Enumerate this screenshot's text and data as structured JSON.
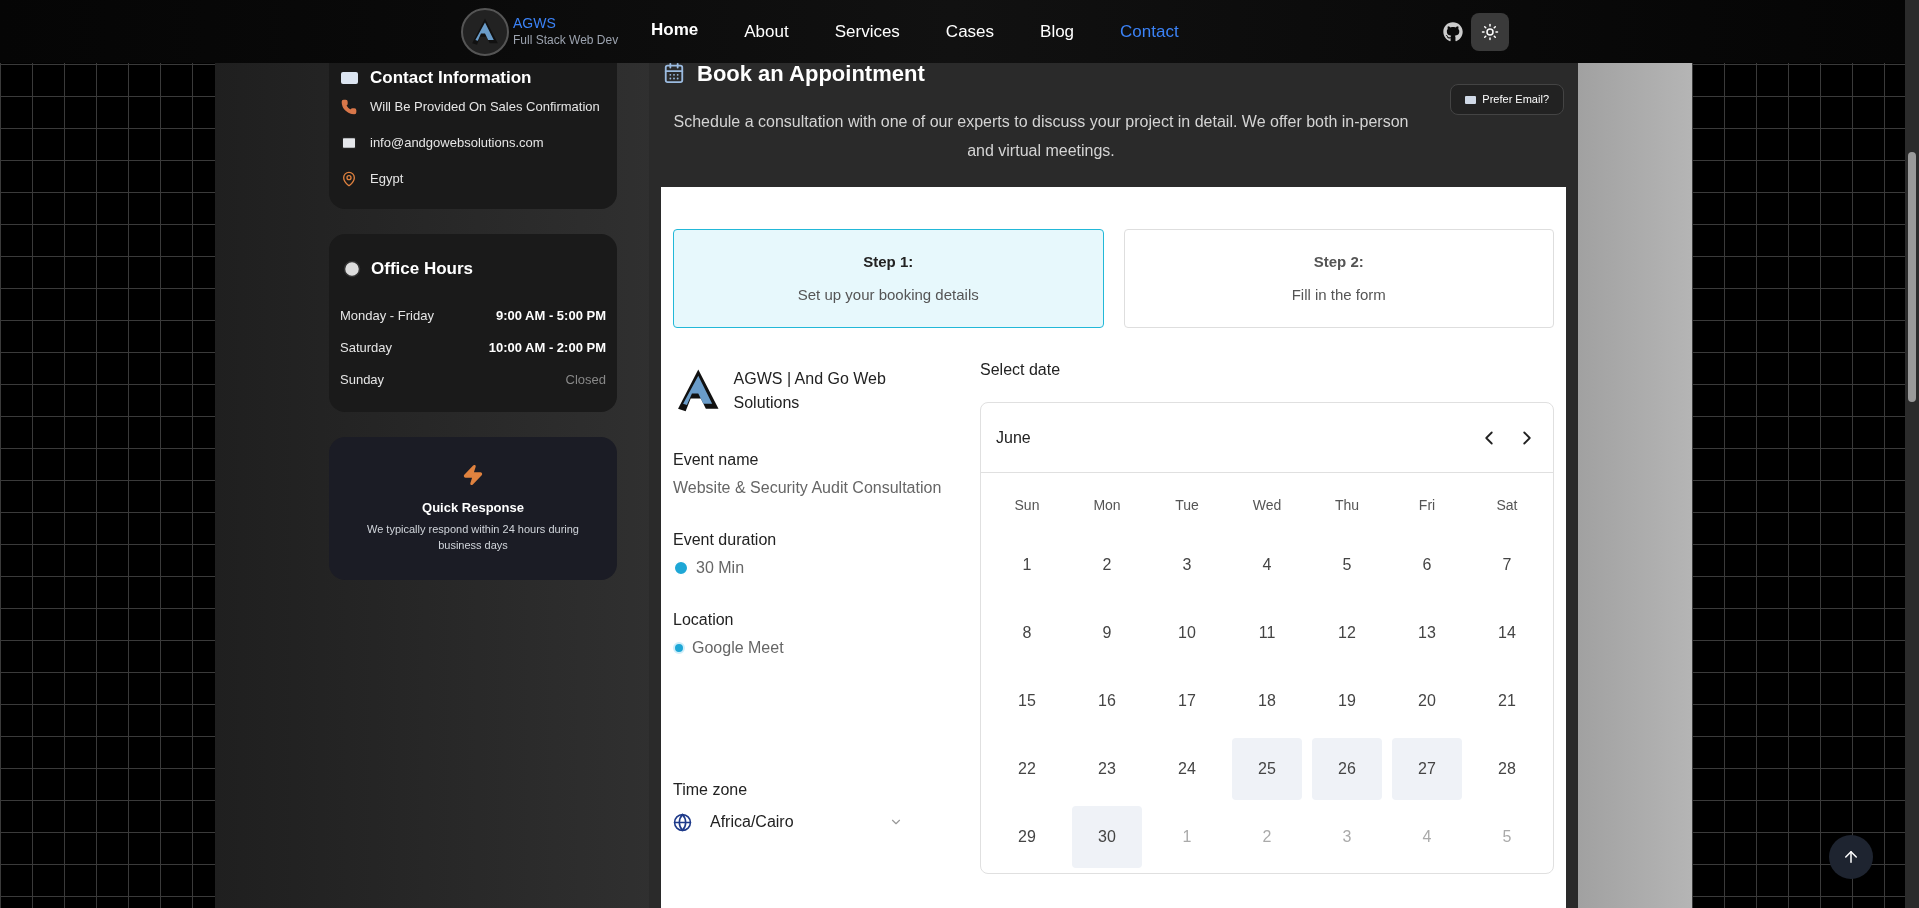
{
  "brand": {
    "name": "AGWS",
    "tagline": "Full Stack Web Dev"
  },
  "nav": [
    {
      "label": "Home",
      "selected": false
    },
    {
      "label": "About",
      "selected": false
    },
    {
      "label": "Services",
      "selected": false
    },
    {
      "label": "Cases",
      "selected": false
    },
    {
      "label": "Blog",
      "selected": false
    },
    {
      "label": "Contact",
      "selected": true
    }
  ],
  "contact": {
    "title": "Contact Information",
    "items": [
      {
        "kind": "phone",
        "text": "Will Be Provided On Sales Confirmation"
      },
      {
        "kind": "email",
        "text": "info@andgowebsolutions.com"
      },
      {
        "kind": "location",
        "text": "Egypt"
      }
    ]
  },
  "hours": {
    "title": "Office Hours",
    "rows": [
      {
        "day": "Monday - Friday",
        "time": "9:00 AM - 5:00 PM",
        "closed": false
      },
      {
        "day": "Saturday",
        "time": "10:00 AM - 2:00 PM",
        "closed": false
      },
      {
        "day": "Sunday",
        "time": "Closed",
        "closed": true
      }
    ]
  },
  "quick": {
    "title": "Quick Response",
    "text": "We typically respond within 24 hours during business days"
  },
  "booking": {
    "title": "Book an Appointment",
    "email_button": "Prefer Email?",
    "description": "Schedule a consultation with one of our experts to discuss your project in detail. We offer both in-person and virtual meetings."
  },
  "steps": [
    {
      "title": "Step 1:",
      "text": "Set up your booking details",
      "selected": true
    },
    {
      "title": "Step 2:",
      "text": "Fill in the form",
      "selected": false
    }
  ],
  "event": {
    "company": "AGWS | And Go Web Solutions",
    "fields": [
      {
        "kind": "name",
        "label": "Event name",
        "value": "Website & Security Audit Consultation"
      },
      {
        "kind": "duration",
        "label": "Event duration",
        "value": "30 Min"
      },
      {
        "kind": "location",
        "label": "Location",
        "value": "Google Meet"
      }
    ],
    "timezone": {
      "label": "Time zone",
      "value": "Africa/Cairo"
    }
  },
  "calendar": {
    "label": "Select date",
    "month": "June",
    "weekdays": [
      "Sun",
      "Mon",
      "Tue",
      "Wed",
      "Thu",
      "Fri",
      "Sat"
    ],
    "days": [
      {
        "label": "1",
        "available": false,
        "outside": false
      },
      {
        "label": "2",
        "available": false,
        "outside": false
      },
      {
        "label": "3",
        "available": false,
        "outside": false
      },
      {
        "label": "4",
        "available": false,
        "outside": false
      },
      {
        "label": "5",
        "available": false,
        "outside": false
      },
      {
        "label": "6",
        "available": false,
        "outside": false
      },
      {
        "label": "7",
        "available": false,
        "outside": false
      },
      {
        "label": "8",
        "available": false,
        "outside": false
      },
      {
        "label": "9",
        "available": false,
        "outside": false
      },
      {
        "label": "10",
        "available": false,
        "outside": false
      },
      {
        "label": "11",
        "available": false,
        "outside": false
      },
      {
        "label": "12",
        "available": false,
        "outside": false
      },
      {
        "label": "13",
        "available": false,
        "outside": false
      },
      {
        "label": "14",
        "available": false,
        "outside": false
      },
      {
        "label": "15",
        "available": false,
        "outside": false
      },
      {
        "label": "16",
        "available": false,
        "outside": false
      },
      {
        "label": "17",
        "available": false,
        "outside": false
      },
      {
        "label": "18",
        "available": false,
        "outside": false
      },
      {
        "label": "19",
        "available": false,
        "outside": false
      },
      {
        "label": "20",
        "available": false,
        "outside": false
      },
      {
        "label": "21",
        "available": false,
        "outside": false
      },
      {
        "label": "22",
        "available": false,
        "outside": false
      },
      {
        "label": "23",
        "available": false,
        "outside": false
      },
      {
        "label": "24",
        "available": false,
        "outside": false
      },
      {
        "label": "25",
        "available": true,
        "outside": false
      },
      {
        "label": "26",
        "available": true,
        "outside": false
      },
      {
        "label": "27",
        "available": true,
        "outside": false
      },
      {
        "label": "28",
        "available": false,
        "outside": false
      },
      {
        "label": "29",
        "available": false,
        "outside": false
      },
      {
        "label": "30",
        "available": true,
        "outside": false
      },
      {
        "label": "1",
        "available": false,
        "outside": true
      },
      {
        "label": "2",
        "available": false,
        "outside": true
      },
      {
        "label": "3",
        "available": false,
        "outside": true
      },
      {
        "label": "4",
        "available": false,
        "outside": true
      },
      {
        "label": "5",
        "available": false,
        "outside": true
      }
    ]
  }
}
